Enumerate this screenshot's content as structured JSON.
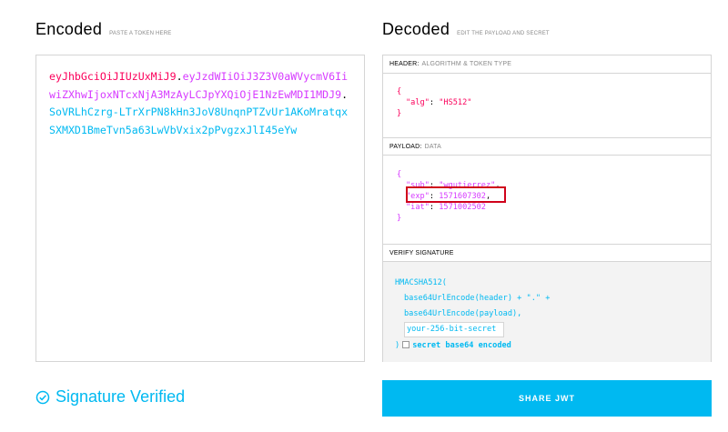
{
  "encoded": {
    "title": "Encoded",
    "hint": "PASTE A TOKEN HERE",
    "token": {
      "header": "eyJhbGciOiJIUzUxMiJ9",
      "payload": "eyJzdWIiOiJ3Z3V0aWVycmV6IiwiZXhwIjoxNTcxNjA3MzAyLCJpYXQiOjE1NzEwMDI1MDJ9",
      "signature": "SoVRLhCzrg-LTrXrPN8kHn3JoV8UnqnPTZvUr1AKoMratqxSXMXD1BmeTvn5a63LwVbVxix2pPvgzxJlI45eYw"
    }
  },
  "decoded": {
    "title": "Decoded",
    "hint": "EDIT THE PAYLOAD AND SECRET",
    "header_section": {
      "label": "HEADER:",
      "sub": "ALGORITHM & TOKEN TYPE",
      "alg_key": "\"alg\"",
      "alg_val": "\"HS512\""
    },
    "payload_section": {
      "label": "PAYLOAD:",
      "sub": "DATA",
      "sub_key": "\"sub\"",
      "sub_val": "\"wgutierrez\"",
      "exp_key": "\"exp\"",
      "exp_val": "1571607302",
      "iat_key": "\"iat\"",
      "iat_val": "1571002502"
    },
    "verify_section": {
      "label": "VERIFY SIGNATURE",
      "fn": "HMACSHA512(",
      "line1": "base64UrlEncode(header) + \".\" +",
      "line2": "base64UrlEncode(payload),",
      "secret_placeholder": "your-256-bit-secret",
      "close": ")",
      "b64_label": "secret base64 encoded"
    }
  },
  "status": {
    "text": "Signature Verified"
  },
  "share_button": {
    "label": "SHARE JWT"
  },
  "colors": {
    "header": "#fb015b",
    "payload": "#d63aff",
    "signature": "#00b9f1",
    "highlight": "#d0021b"
  }
}
